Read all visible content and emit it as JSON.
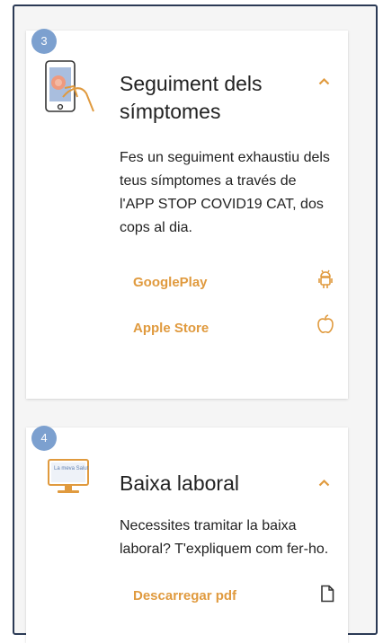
{
  "steps": [
    {
      "number": "3",
      "title_line1": "Seguiment dels",
      "title_line2": "símptomes",
      "description_lines": [
        "Fes un seguiment exhaustiu dels",
        "teus símptomes a través de",
        "l'APP STOP COVID19 CAT, dos",
        "cops al dia."
      ],
      "links": [
        {
          "label": "GooglePlay",
          "icon": "android-icon"
        },
        {
          "label": "Apple Store",
          "icon": "apple-icon"
        }
      ]
    },
    {
      "number": "4",
      "title": "Baixa laboral",
      "image_text": "La meva Salut",
      "description_lines": [
        "Necessites tramitar la baixa",
        "laboral? T'expliquem com fer-ho."
      ],
      "links": [
        {
          "label": "Descarregar pdf",
          "icon": "document-icon"
        }
      ]
    }
  ],
  "colors": {
    "accent": "#e09a3e",
    "badge": "#7ca0cf",
    "text": "#222222",
    "frame": "#2b3a55"
  }
}
